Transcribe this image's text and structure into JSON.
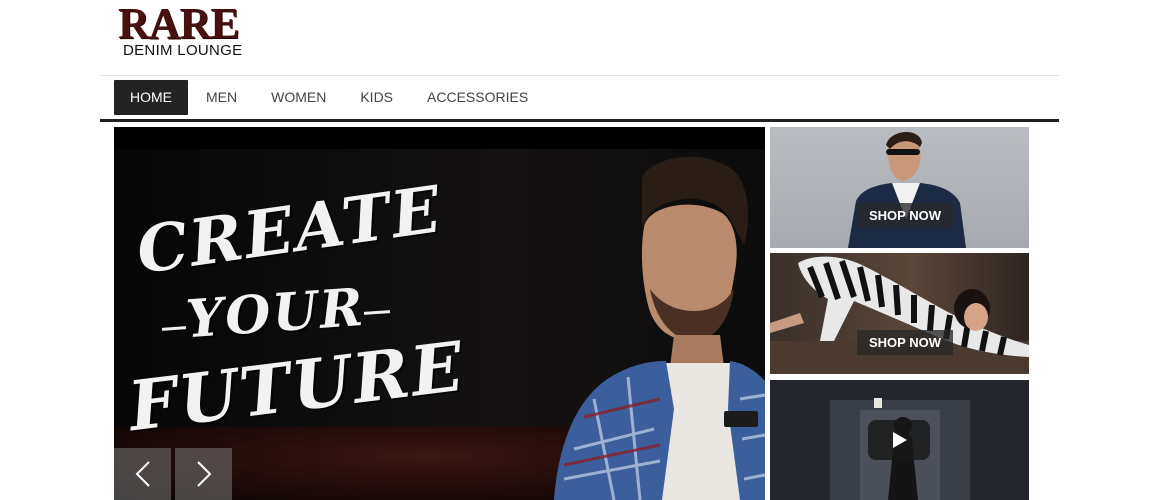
{
  "brand": {
    "logo_text": "RARE",
    "logo_subtitle": "DENIM LOUNGE"
  },
  "nav": {
    "items": [
      {
        "label": "HOME",
        "active": true
      },
      {
        "label": "MEN",
        "active": false
      },
      {
        "label": "WOMEN",
        "active": false
      },
      {
        "label": "KIDS",
        "active": false
      },
      {
        "label": "ACCESSORIES",
        "active": false
      }
    ]
  },
  "hero": {
    "headline_line1": "CREATE",
    "headline_line2": "YOUR",
    "headline_line3": "FUTURE",
    "prev_icon": "chevron-left-icon",
    "next_icon": "chevron-right-icon"
  },
  "tiles": [
    {
      "button_label": "SHOP NOW",
      "image": "man-in-suit-with-sunglasses"
    },
    {
      "button_label": "SHOP NOW",
      "image": "woman-in-striped-dress"
    },
    {
      "icon": "play-icon",
      "image": "video-thumbnail-corridor"
    }
  ],
  "colors": {
    "nav_active_bg": "#232323",
    "logo": "#4a0f0f",
    "rule": "#1f1f1f"
  }
}
